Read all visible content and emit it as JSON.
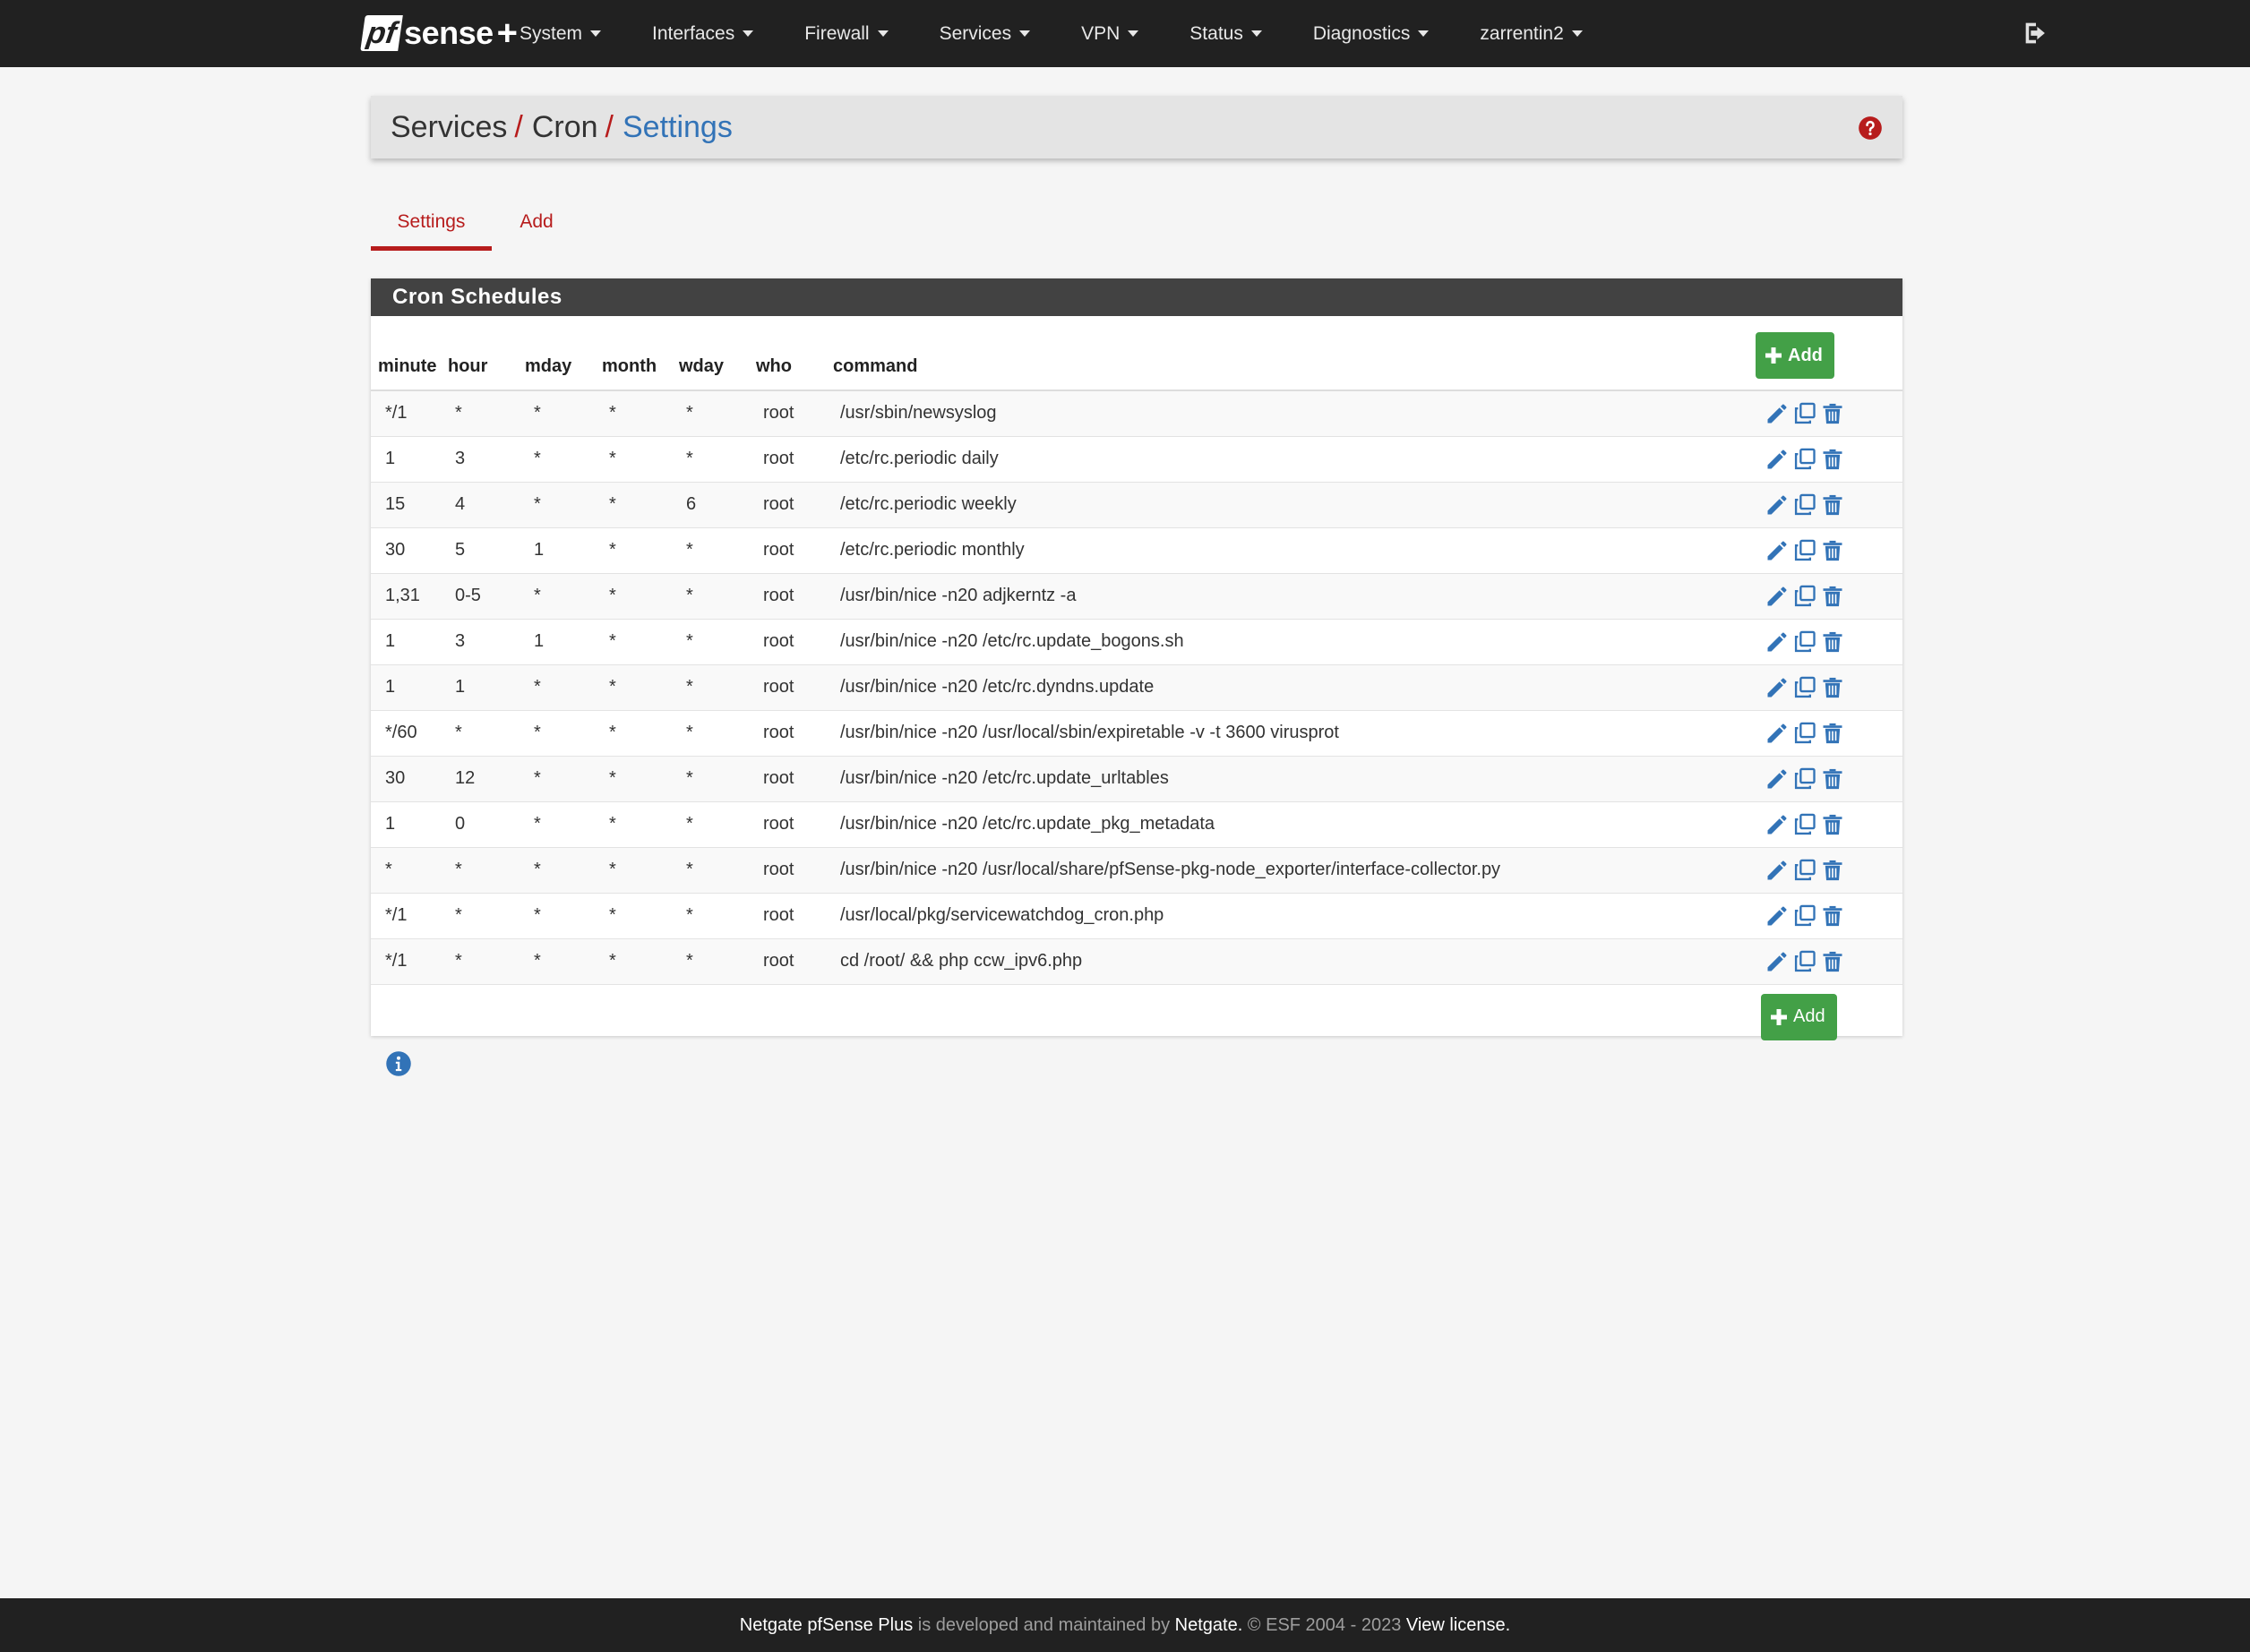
{
  "brand": {
    "pf": "pf",
    "sense": "sense",
    "plus": "+"
  },
  "nav": {
    "items": [
      {
        "label": "System"
      },
      {
        "label": "Interfaces"
      },
      {
        "label": "Firewall"
      },
      {
        "label": "Services"
      },
      {
        "label": "VPN"
      },
      {
        "label": "Status"
      },
      {
        "label": "Diagnostics"
      },
      {
        "label": "zarrentin2"
      }
    ],
    "logout_icon": "sign-out-icon"
  },
  "breadcrumb": {
    "items": [
      "Services",
      "Cron",
      "Settings"
    ],
    "separator": "/",
    "help_icon": "question-circle-icon"
  },
  "tabs": [
    {
      "label": "Settings",
      "active": true
    },
    {
      "label": "Add",
      "active": false
    }
  ],
  "panel": {
    "title": "Cron Schedules",
    "add_label": "Add",
    "columns": [
      "minute",
      "hour",
      "mday",
      "month",
      "wday",
      "who",
      "command"
    ],
    "rows": [
      {
        "minute": "*/1",
        "hour": "*",
        "mday": "*",
        "month": "*",
        "wday": "*",
        "who": "root",
        "command": "/usr/sbin/newsyslog"
      },
      {
        "minute": "1",
        "hour": "3",
        "mday": "*",
        "month": "*",
        "wday": "*",
        "who": "root",
        "command": "/etc/rc.periodic daily"
      },
      {
        "minute": "15",
        "hour": "4",
        "mday": "*",
        "month": "*",
        "wday": "6",
        "who": "root",
        "command": "/etc/rc.periodic weekly"
      },
      {
        "minute": "30",
        "hour": "5",
        "mday": "1",
        "month": "*",
        "wday": "*",
        "who": "root",
        "command": "/etc/rc.periodic monthly"
      },
      {
        "minute": "1,31",
        "hour": "0-5",
        "mday": "*",
        "month": "*",
        "wday": "*",
        "who": "root",
        "command": "/usr/bin/nice -n20 adjkerntz -a"
      },
      {
        "minute": "1",
        "hour": "3",
        "mday": "1",
        "month": "*",
        "wday": "*",
        "who": "root",
        "command": "/usr/bin/nice -n20 /etc/rc.update_bogons.sh"
      },
      {
        "minute": "1",
        "hour": "1",
        "mday": "*",
        "month": "*",
        "wday": "*",
        "who": "root",
        "command": "/usr/bin/nice -n20 /etc/rc.dyndns.update"
      },
      {
        "minute": "*/60",
        "hour": "*",
        "mday": "*",
        "month": "*",
        "wday": "*",
        "who": "root",
        "command": "/usr/bin/nice -n20 /usr/local/sbin/expiretable -v -t 3600 virusprot"
      },
      {
        "minute": "30",
        "hour": "12",
        "mday": "*",
        "month": "*",
        "wday": "*",
        "who": "root",
        "command": "/usr/bin/nice -n20 /etc/rc.update_urltables"
      },
      {
        "minute": "1",
        "hour": "0",
        "mday": "*",
        "month": "*",
        "wday": "*",
        "who": "root",
        "command": "/usr/bin/nice -n20 /etc/rc.update_pkg_metadata"
      },
      {
        "minute": "*",
        "hour": "*",
        "mday": "*",
        "month": "*",
        "wday": "*",
        "who": "root",
        "command": "/usr/bin/nice -n20 /usr/local/share/pfSense-pkg-node_exporter/interface-collector.py"
      },
      {
        "minute": "*/1",
        "hour": "*",
        "mday": "*",
        "month": "*",
        "wday": "*",
        "who": "root",
        "command": "/usr/local/pkg/servicewatchdog_cron.php"
      },
      {
        "minute": "*/1",
        "hour": "*",
        "mday": "*",
        "month": "*",
        "wday": "*",
        "who": "root",
        "command": "cd /root/ && php ccw_ipv6.php"
      }
    ],
    "row_actions": [
      "pencil-icon",
      "clone-icon",
      "trash-icon"
    ]
  },
  "info_icon": "info-circle-icon",
  "footer": {
    "product": "Netgate pfSense Plus",
    "middle": " is developed and maintained by ",
    "company": "Netgate.",
    "copyright": " © ESF 2004 - 2023 ",
    "license_link": "View license."
  },
  "colors": {
    "navbar": "#212121",
    "accent_red": "#b71c1c",
    "link_blue": "#3273b7",
    "add_green": "#43a047",
    "panel_heading": "#424242"
  }
}
